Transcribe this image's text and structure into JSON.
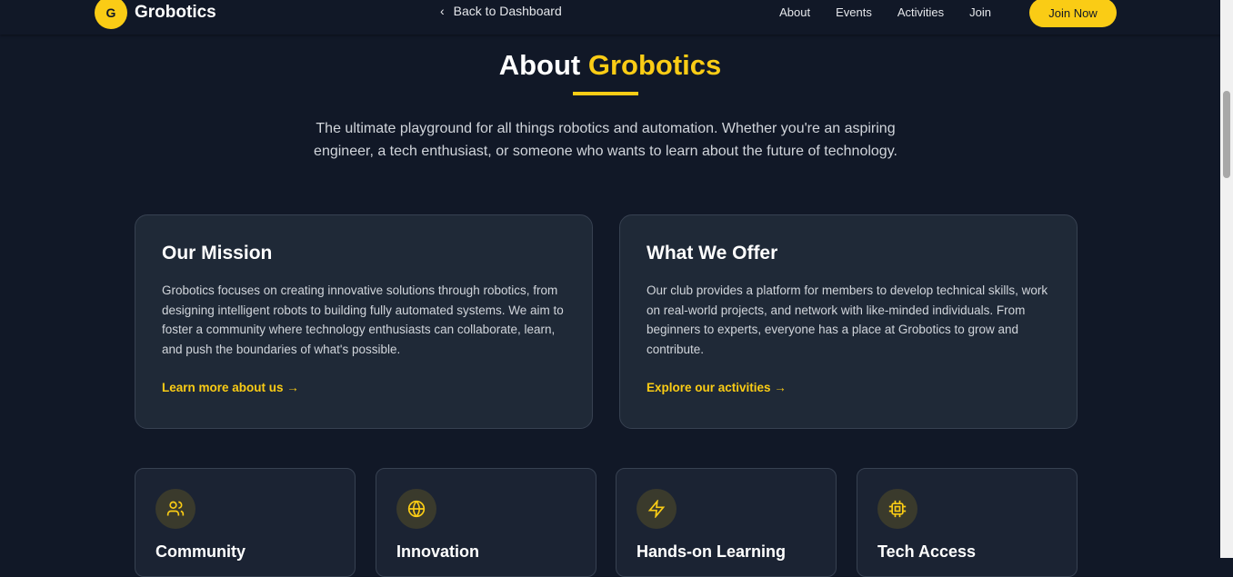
{
  "nav": {
    "logo_letter": "G",
    "brand": "Grobotics",
    "back": "Back to Dashboard",
    "links": [
      "About",
      "Events",
      "Activities",
      "Join"
    ],
    "join": "Join Now"
  },
  "hero": {
    "title_a": "About ",
    "title_b": "Grobotics",
    "lead": "The ultimate playground for all things robotics and automation. Whether you're an aspiring engineer, a tech enthusiast, or someone who wants to learn about the future of technology."
  },
  "cards": [
    {
      "title": "Our Mission",
      "body": "Grobotics focuses on creating innovative solutions through robotics, from designing intelligent robots to building fully automated systems. We aim to foster a community where technology enthusiasts can collaborate, learn, and push the boundaries of what's possible.",
      "link": "Learn more about us →"
    },
    {
      "title": "What We Offer",
      "body": "Our club provides a platform for members to develop technical skills, work on real-world projects, and network with like-minded individuals. From beginners to experts, everyone has a place at Grobotics to grow and contribute.",
      "link": "Explore our activities →"
    }
  ],
  "features": [
    {
      "title": "Community",
      "icon": "users-icon"
    },
    {
      "title": "Innovation",
      "icon": "globe-icon"
    },
    {
      "title": "Hands-on Learning",
      "icon": "lightning-icon"
    },
    {
      "title": "Tech Access",
      "icon": "chip-icon"
    }
  ]
}
